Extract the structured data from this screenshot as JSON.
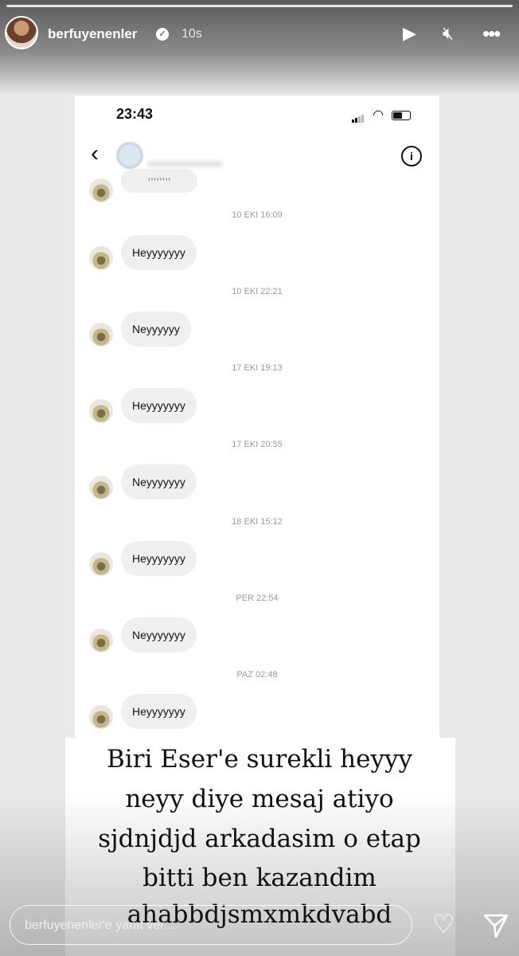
{
  "story": {
    "username": "berfuyenenler",
    "time_ago": "10s",
    "icons": {
      "play": "play-icon",
      "mute": "mute-icon",
      "more": "more-icon",
      "verified": "verified-badge-icon"
    }
  },
  "screenshot": {
    "status_time": "23:43",
    "partial_text": ",,,,,,,,",
    "messages": [
      {
        "timestamp": "10 EKI 16:09",
        "text": "Heyyyyyyy"
      },
      {
        "timestamp": "10 EKI 22:21",
        "text": "Neyyyyyy"
      },
      {
        "timestamp": "17 EKI 19:13",
        "text": "Heyyyyyyy"
      },
      {
        "timestamp": "17 EKI 20:55",
        "text": "Neyyyyyyy"
      },
      {
        "timestamp": "18 EKI 15:12",
        "text": "Heyyyyyyy"
      },
      {
        "timestamp": "PER 22:54",
        "text": "Neyyyyyyy"
      },
      {
        "timestamp": "PAZ 02:48",
        "text": "Heyyyyyyy"
      }
    ]
  },
  "caption": {
    "lines": [
      "Biri Eser'e surekli heyyy",
      "neyy diye mesaj atiyo",
      "sjdnjdjd arkadasim o etap",
      "bitti ben kazandim",
      "ahabbdjsmxmkdvabd"
    ]
  },
  "reply": {
    "placeholder": "berfuyenenler'e yanıt ver..."
  }
}
